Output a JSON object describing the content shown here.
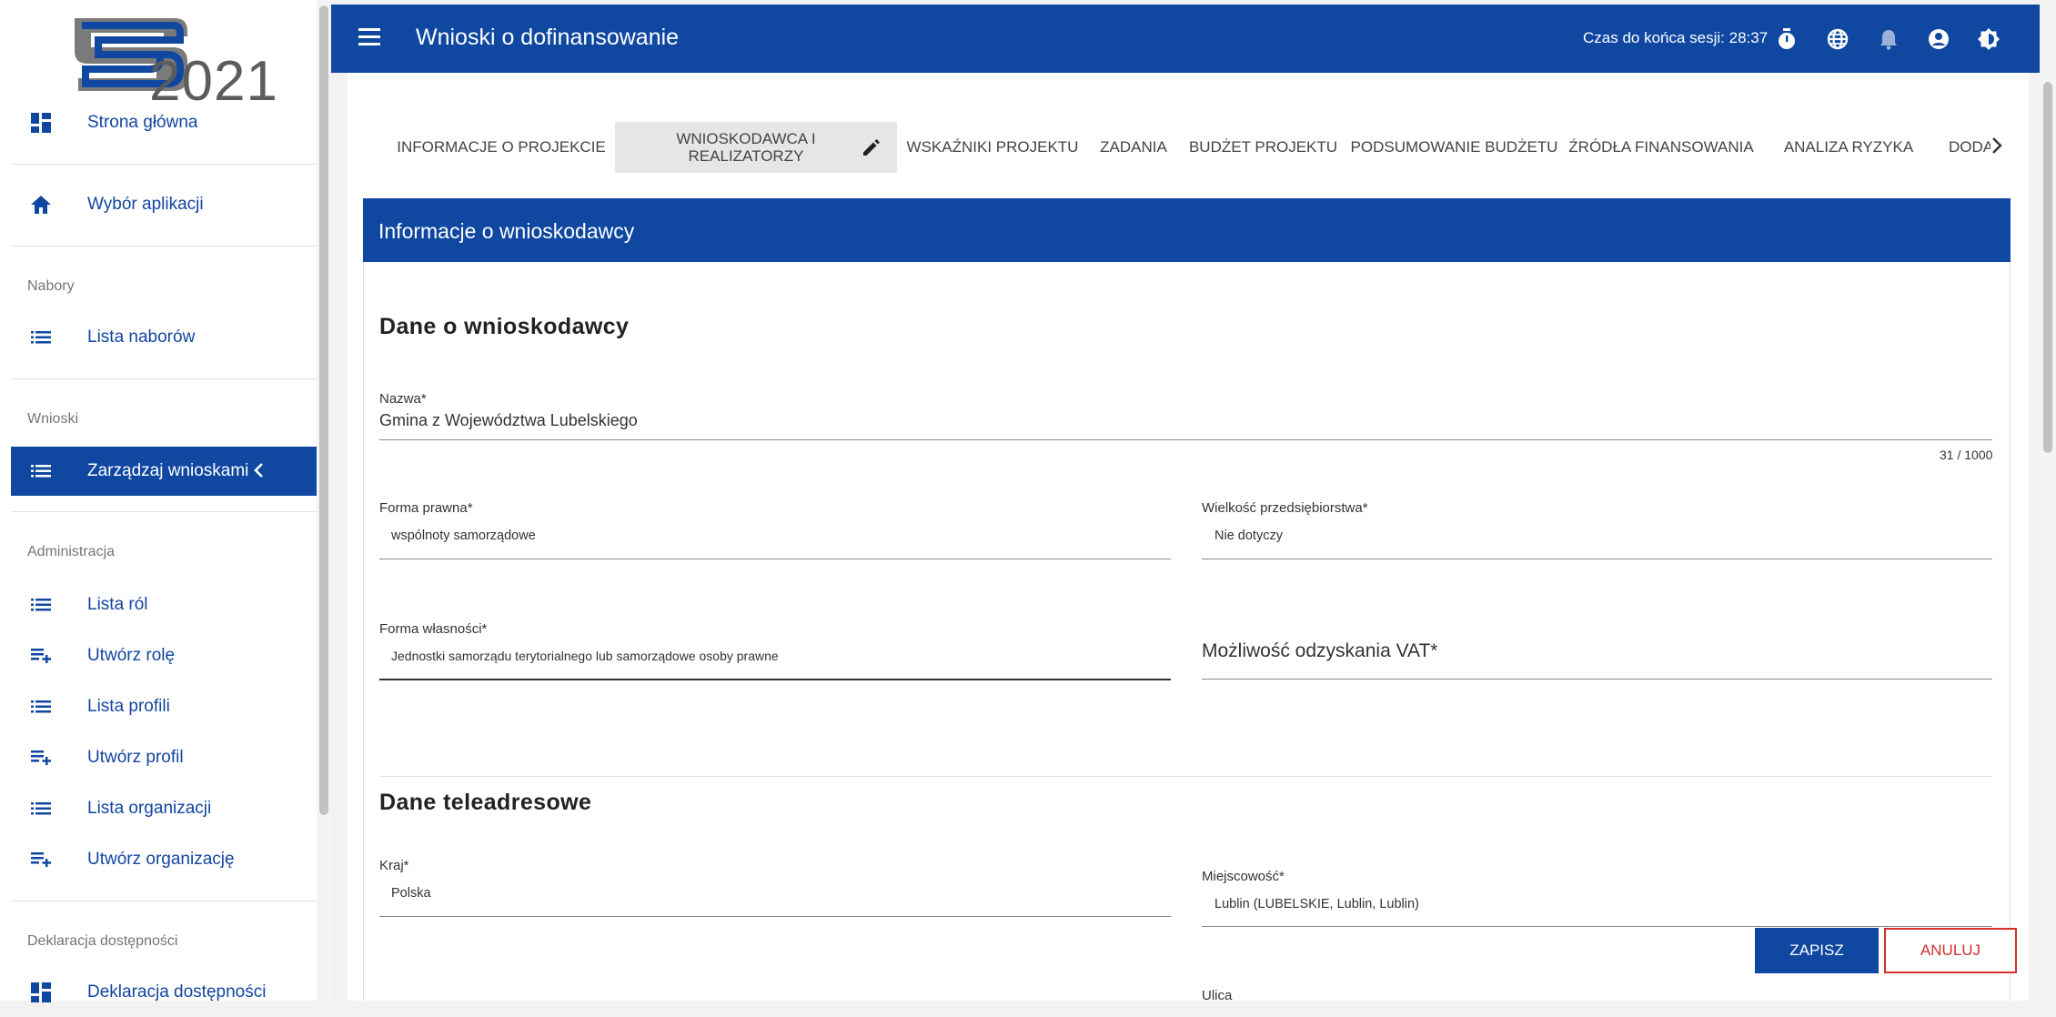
{
  "sidebar": {
    "logo_text": "2021",
    "items": [
      {
        "label": "Strona główna",
        "icon": "dashboard-icon"
      },
      {
        "label": "Wybór aplikacji",
        "icon": "home-icon"
      }
    ],
    "sections": {
      "nabory": {
        "title": "Nabory",
        "items": [
          {
            "label": "Lista naborów",
            "icon": "list-icon"
          }
        ]
      },
      "wnioski": {
        "title": "Wnioski",
        "items": [
          {
            "label": "Zarządzaj wnioskami",
            "icon": "list-icon",
            "active": true
          }
        ]
      },
      "administracja": {
        "title": "Administracja",
        "items": [
          {
            "label": "Lista ról",
            "icon": "list-icon"
          },
          {
            "label": "Utwórz rolę",
            "icon": "playlist-add-icon"
          },
          {
            "label": "Lista profili",
            "icon": "list-icon"
          },
          {
            "label": "Utwórz profil",
            "icon": "playlist-add-icon"
          },
          {
            "label": "Lista organizacji",
            "icon": "list-icon"
          },
          {
            "label": "Utwórz organizację",
            "icon": "playlist-add-icon"
          }
        ]
      },
      "deklaracja": {
        "title": "Deklaracja dostępności",
        "items": [
          {
            "label": "Deklaracja dostępności",
            "icon": "dashboard-icon"
          }
        ]
      }
    }
  },
  "topbar": {
    "title": "Wnioski o dofinansowanie",
    "session_label": "Czas do końca sesji: 28:37",
    "icons": [
      "timer-icon",
      "language-icon",
      "notifications-icon",
      "account-icon",
      "theme-icon"
    ]
  },
  "tabs": [
    {
      "label": "INFORMACJE O PROJEKCIE"
    },
    {
      "label_line1": "WNIOSKODAWCA I",
      "label_line2": "REALIZATORZY",
      "active": true
    },
    {
      "label": "WSKAŹNIKI PROJEKTU"
    },
    {
      "label": "ZADANIA"
    },
    {
      "label": "BUDŻET PROJEKTU"
    },
    {
      "label": "PODSUMOWANIE BUDŻETU"
    },
    {
      "label": "ŹRÓDŁA FINANSOWANIA"
    },
    {
      "label": "ANALIZA RYZYKA"
    },
    {
      "label": "DODAT"
    }
  ],
  "panel": {
    "title": "Informacje o wnioskodawcy",
    "section1_title": "Dane o wnioskodawcy",
    "nazwa": {
      "label": "Nazwa*",
      "value": "Gmina z Województwa Lubelskiego",
      "counter": "31 / 1000"
    },
    "forma_prawna": {
      "label": "Forma prawna*",
      "value": "wspólnoty samorządowe"
    },
    "wielkosc": {
      "label": "Wielkość przedsiębiorstwa*",
      "value": "Nie dotyczy"
    },
    "forma_wlasnosci": {
      "label": "Forma własności*",
      "value": "Jednostki samorządu terytorialnego lub samorządowe osoby prawne"
    },
    "vat": {
      "label": "Możliwość odzyskania VAT*"
    },
    "section2_title": "Dane teleadresowe",
    "kraj": {
      "label": "Kraj*",
      "value": "Polska"
    },
    "miejscowosc": {
      "label": "Miejscowość*",
      "value": "Lublin (LUBELSKIE, Lublin, Lublin)"
    },
    "ulica": {
      "label": "Ulica"
    }
  },
  "actions": {
    "save": "ZAPISZ",
    "cancel": "ANULUJ"
  },
  "colors": {
    "primary": "#0f47a1",
    "danger": "#d32f2f"
  }
}
